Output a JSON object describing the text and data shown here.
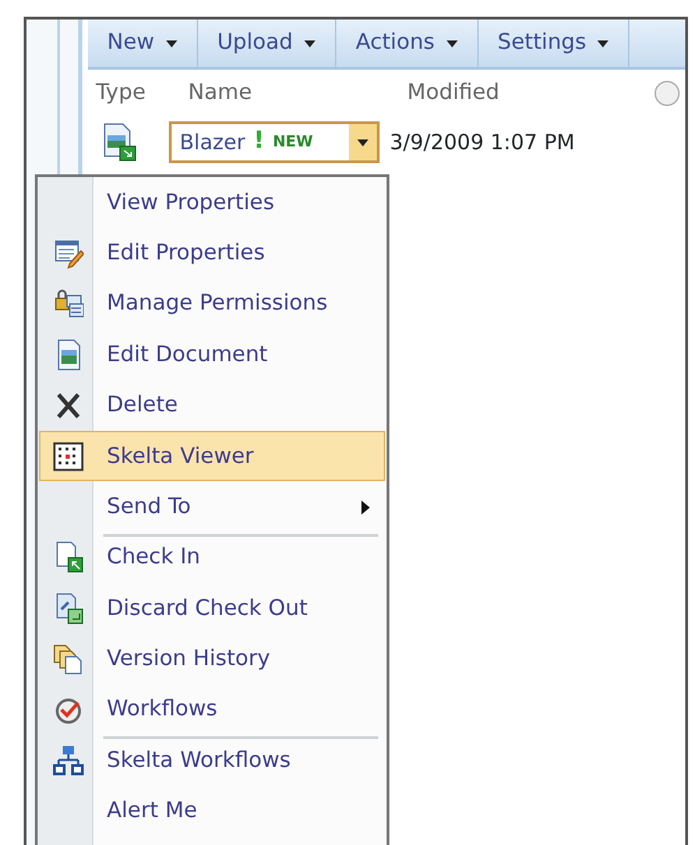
{
  "toolbar": [
    {
      "label": "New",
      "dropdown": true
    },
    {
      "label": "Upload",
      "dropdown": true
    },
    {
      "label": "Actions",
      "dropdown": true
    },
    {
      "label": "Settings",
      "dropdown": true
    }
  ],
  "columns": [
    "Type",
    "Name",
    "Modified"
  ],
  "row": {
    "name": "Blazer",
    "new_mark": "!",
    "new_label": "NEW",
    "modified": "3/9/2009 1:07 PM",
    "menu_open": true
  },
  "menu": [
    {
      "label": "View Properties",
      "kind": "none",
      "selected": false,
      "submenu": false,
      "separator_before": false
    },
    {
      "label": "Edit Properties",
      "kind": "edit-form",
      "selected": false,
      "submenu": false,
      "separator_before": false
    },
    {
      "label": "Manage Permissions",
      "kind": "lock",
      "selected": false,
      "submenu": false,
      "separator_before": false
    },
    {
      "label": "Edit Document",
      "kind": "document",
      "selected": false,
      "submenu": false,
      "separator_before": false
    },
    {
      "label": "Delete",
      "kind": "delete",
      "selected": false,
      "submenu": false,
      "separator_before": false
    },
    {
      "label": "Skelta Viewer",
      "kind": "grid",
      "selected": true,
      "submenu": false,
      "separator_before": false
    },
    {
      "label": "Send To",
      "kind": "none",
      "selected": false,
      "submenu": true,
      "separator_before": false
    },
    {
      "label": "Check In",
      "kind": "check-in",
      "selected": false,
      "submenu": false,
      "separator_before": true
    },
    {
      "label": "Discard Check Out",
      "kind": "discard",
      "selected": false,
      "submenu": false,
      "separator_before": false
    },
    {
      "label": "Version History",
      "kind": "versions",
      "selected": false,
      "submenu": false,
      "separator_before": false
    },
    {
      "label": "Workflows",
      "kind": "workflow",
      "selected": false,
      "submenu": false,
      "separator_before": false
    },
    {
      "label": "Skelta Workflows",
      "kind": "hierarchy",
      "selected": false,
      "submenu": false,
      "separator_before": true
    },
    {
      "label": "Alert Me",
      "kind": "none",
      "selected": false,
      "submenu": false,
      "separator_before": false
    }
  ]
}
